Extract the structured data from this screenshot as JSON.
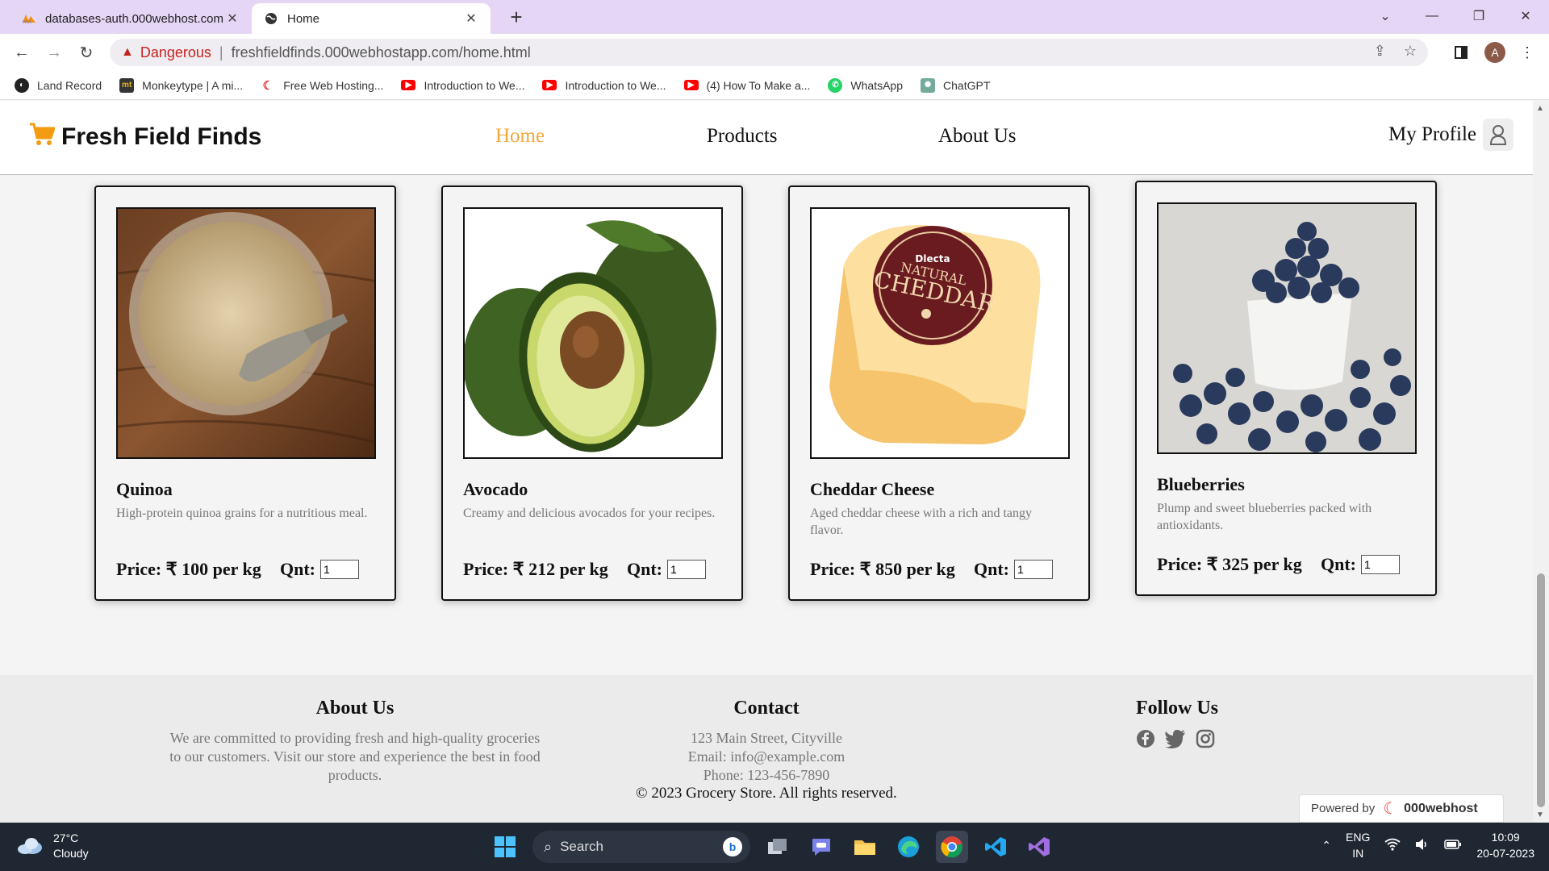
{
  "browser": {
    "tabs": [
      {
        "title": "databases-auth.000webhost.com",
        "active": false
      },
      {
        "title": "Home",
        "active": true
      }
    ],
    "security_label": "Dangerous",
    "url": "freshfieldfinds.000webhostapp.com/home.html",
    "profile_initial": "A",
    "bookmarks": [
      {
        "label": "Land Record",
        "color": "#222222"
      },
      {
        "label": "Monkeytype | A mi...",
        "color": "#323437"
      },
      {
        "label": "Free Web Hosting...",
        "color": "#e53935"
      },
      {
        "label": "Introduction to We...",
        "color": "#ff0000"
      },
      {
        "label": "Introduction to We...",
        "color": "#ff0000"
      },
      {
        "label": "(4) How To Make a...",
        "color": "#ff0000"
      },
      {
        "label": "WhatsApp",
        "color": "#25d366"
      },
      {
        "label": "ChatGPT",
        "color": "#74aa9c"
      }
    ]
  },
  "site": {
    "logo_text": "Fresh Field Finds",
    "nav": [
      "Home",
      "Products",
      "About Us"
    ],
    "active_nav": "Home",
    "profile_label": "My Profile",
    "accent_color": "#f3a73b"
  },
  "products": [
    {
      "name": "Quinoa",
      "description": "High-protein quinoa grains for a nutritious meal.",
      "price": "Price: ₹ 100 per kg",
      "qnt_label": "Qnt:",
      "qty": "1"
    },
    {
      "name": "Avocado",
      "description": "Creamy and delicious avocados for your recipes.",
      "price": "Price: ₹ 212 per kg",
      "qnt_label": "Qnt:",
      "qty": "1"
    },
    {
      "name": "Cheddar Cheese",
      "description": "Aged cheddar cheese with a rich and tangy flavor.",
      "price": "Price: ₹ 850 per kg",
      "qnt_label": "Qnt:",
      "qty": "1",
      "label_top": "Dlecta",
      "label_main": "NATURAL",
      "label_sub": "CHEDDAR"
    },
    {
      "name": "Blueberries",
      "description": "Plump and sweet blueberries packed with antioxidants.",
      "price": "Price: ₹ 325 per kg",
      "qnt_label": "Qnt:",
      "qty": "1"
    }
  ],
  "footer": {
    "about": {
      "title": "About Us",
      "text": "We are committed to providing fresh and high-quality groceries to our customers. Visit our store and experience the best in food products."
    },
    "contact": {
      "title": "Contact",
      "address": "123 Main Street, Cityville",
      "email": "Email: info@example.com",
      "phone": "Phone: 123-456-7890"
    },
    "follow": {
      "title": "Follow Us",
      "icons": [
        "facebook-icon",
        "twitter-icon",
        "instagram-icon"
      ]
    },
    "copyright": "© 2023 Grocery Store. All rights reserved.",
    "powered_by": "Powered by",
    "powered_brand": "000webhost"
  },
  "taskbar": {
    "temperature": "27°C",
    "weather": "Cloudy",
    "search_label": "Search",
    "lang_top": "ENG",
    "lang_bottom": "IN",
    "time": "10:09",
    "date": "20-07-2023"
  }
}
